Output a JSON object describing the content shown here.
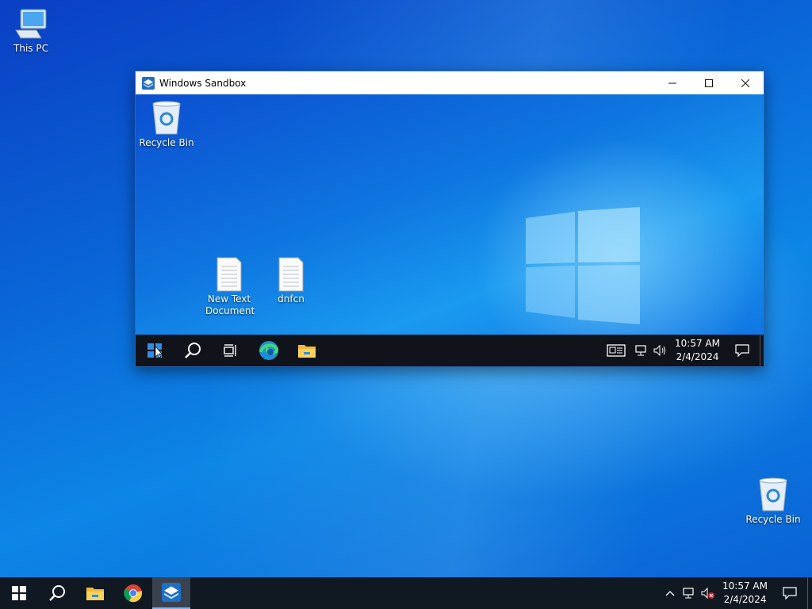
{
  "desktop": {
    "icons": [
      {
        "label": "This PC",
        "icon": "this-pc-icon"
      },
      {
        "label": "Recycle Bin",
        "icon": "recycle-bin-icon"
      }
    ]
  },
  "sandbox": {
    "title": "Windows Sandbox",
    "desktop_icons": [
      {
        "label": "Recycle Bin",
        "icon": "recycle-bin-icon"
      },
      {
        "label": "New Text Document",
        "icon": "text-file-icon"
      },
      {
        "label": "dnfcn",
        "icon": "text-file-icon"
      }
    ],
    "taskbar": {
      "time": "10:57 AM",
      "date": "2/4/2024",
      "apps": [
        "start-icon",
        "search-icon",
        "task-view-icon",
        "edge-icon",
        "file-explorer-icon"
      ],
      "tray": [
        "news-icon",
        "network-icon",
        "volume-icon",
        "notification-icon"
      ]
    }
  },
  "taskbar": {
    "time": "10:57 AM",
    "date": "2/4/2024",
    "apps": [
      "start-icon",
      "search-icon",
      "file-explorer-icon",
      "chrome-icon",
      "windows-sandbox-icon"
    ],
    "tray": [
      "show-hidden-icons-chevron",
      "network-icon",
      "volume-muted-icon",
      "notification-icon"
    ]
  }
}
